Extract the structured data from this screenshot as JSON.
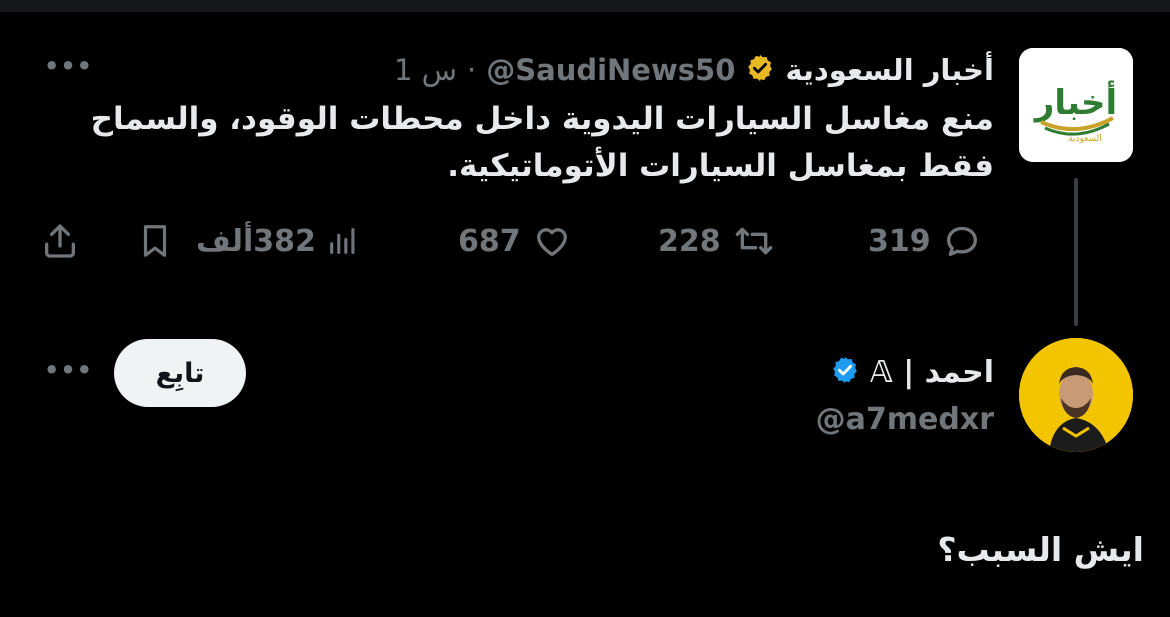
{
  "colors": {
    "background": "#000000",
    "text_primary": "#e7e9ea",
    "text_secondary": "#71767b",
    "gold_badge": "#e8b923",
    "blue_badge": "#1d9bf0",
    "follow_button_bg": "#eff3f4"
  },
  "original_tweet": {
    "author_name": "أخبار السعودية",
    "verified_badge": "gold-check-icon",
    "handle": "@SaudiNews50",
    "separator": "·",
    "time": "1 س",
    "more_icon": "more-dots-icon",
    "avatar_logo_text": "أخبار",
    "avatar_logo_subtext": "السعودية",
    "text": "منع مغاسل السيارات اليدوية داخل محطات الوقود، والسماح فقط بمغاسل السيارات الأتوماتيكية.",
    "actions": {
      "replies": "319",
      "retweets": "228",
      "likes": "687",
      "views": "382ألف"
    }
  },
  "reply": {
    "author_name": "احمد | 𝔸",
    "verified_badge": "blue-check-icon",
    "handle": "@a7medxr",
    "follow_label": "تابِع",
    "more_icon": "more-dots-icon",
    "text": "ايش السبب؟"
  }
}
